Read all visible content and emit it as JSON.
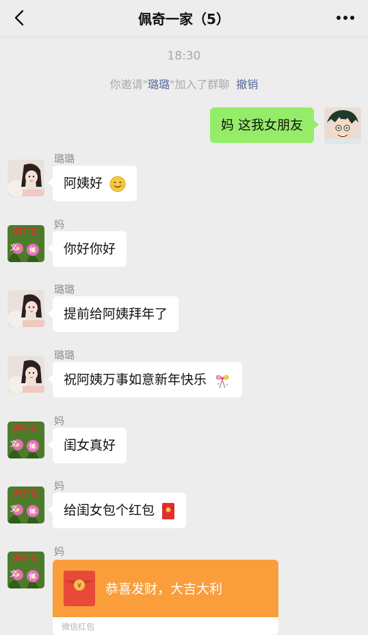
{
  "header": {
    "title": "佩奇一家（5）"
  },
  "time": "18:30",
  "system_message": {
    "prefix": "你邀请\"",
    "invitee": "璐璐",
    "suffix": "\"加入了群聊",
    "revoke": "撤销"
  },
  "messages": [
    {
      "sender": "me",
      "text": "妈 这我女朋友"
    },
    {
      "sender": "璐璐",
      "text": "阿姨好",
      "emoji": "smile-emoji"
    },
    {
      "sender": "妈",
      "text": "你好你好"
    },
    {
      "sender": "璐璐",
      "text": "提前给阿姨拜年了"
    },
    {
      "sender": "璐璐",
      "text": "祝阿姨万事如意新年快乐",
      "emoji": "celebrate-emoji"
    },
    {
      "sender": "妈",
      "text": "闺女真好"
    },
    {
      "sender": "妈",
      "text": "给闺女包个红包",
      "emoji": "red-envelope-emoji"
    },
    {
      "sender": "妈",
      "type": "red_packet"
    }
  ],
  "red_packet": {
    "greeting": "恭喜发财，大吉大利",
    "label": "微信红包",
    "symbol": "¥"
  },
  "avatars": {
    "mom_text_top": "两开花",
    "mom_text_left": "文",
    "mom_text_center": "体"
  },
  "colors": {
    "background": "#ededed",
    "my_bubble": "#95ec69",
    "their_bubble": "#ffffff",
    "link": "#576b95",
    "red_packet": "#fa9d3b"
  }
}
